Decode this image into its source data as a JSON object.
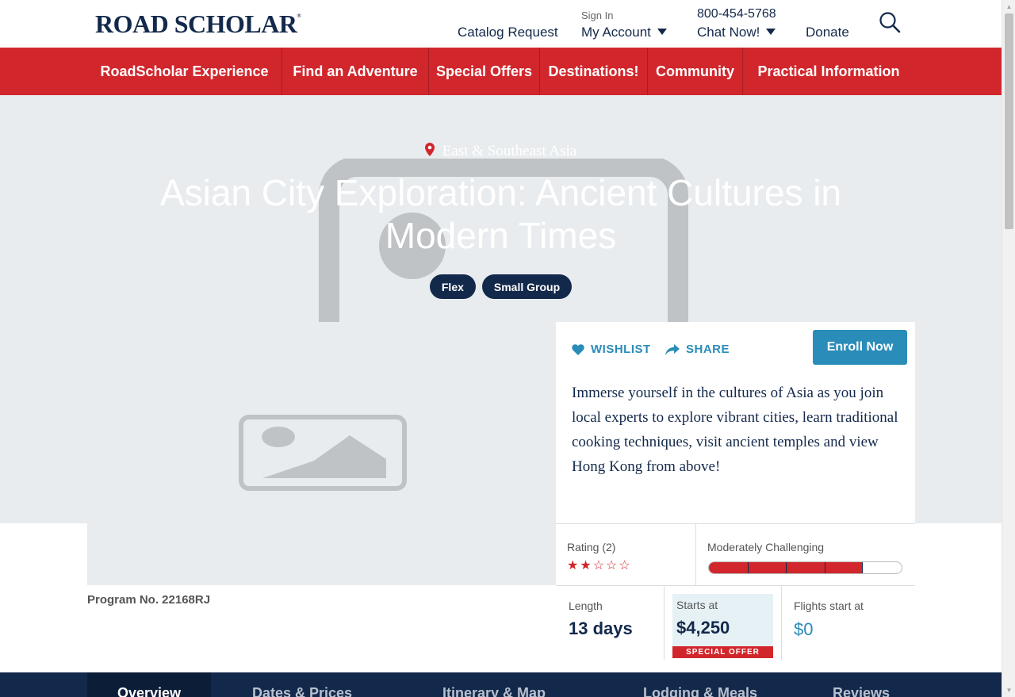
{
  "header": {
    "logo_text": "ROAD SCHOLAR",
    "logo_mark": "®",
    "catalog_request": "Catalog Request",
    "sign_in": "Sign In",
    "my_account": "My Account",
    "phone": "800-454-5768",
    "chat_now": "Chat Now!",
    "donate": "Donate"
  },
  "nav": {
    "items": [
      {
        "label": "RoadScholar Experience"
      },
      {
        "label": "Find an Adventure"
      },
      {
        "label": "Special Offers"
      },
      {
        "label": "Destinations!"
      },
      {
        "label": "Community"
      },
      {
        "label": "Practical Information"
      }
    ]
  },
  "hero": {
    "region": "East & Southeast Asia",
    "title": "Asian City Exploration: Ancient Cultures in Modern Times",
    "tags": [
      "Flex",
      "Small Group"
    ]
  },
  "card": {
    "wishlist": "WISHLIST",
    "share": "SHARE",
    "enroll": "Enroll Now",
    "description": "Immerse yourself in the cultures of Asia as you join local experts to explore vibrant cities, learn traditional cooking techniques, visit ancient temples and view Hong Kong from above!"
  },
  "stats": {
    "rating_label": "Rating (2)",
    "rating_stars": 2,
    "rating_max": 5,
    "difficulty_label": "Moderately Challenging",
    "difficulty_level": 4,
    "difficulty_max": 5,
    "length_label": "Length",
    "length_value": "13 days",
    "price_label": "Starts at",
    "price_value": "$4,250",
    "special_offer": "SPECIAL OFFER",
    "flights_label": "Flights start at",
    "flights_value": "$0"
  },
  "program": "Program No. 22168RJ",
  "tabs": [
    {
      "label": "Overview",
      "active": true
    },
    {
      "label": "Dates & Prices",
      "active": false
    },
    {
      "label": "Itinerary & Map",
      "active": false
    },
    {
      "label": "Lodging & Meals",
      "active": false
    },
    {
      "label": "Reviews",
      "active": false
    }
  ],
  "colors": {
    "brand_red": "#d1262c",
    "navy": "#13294b",
    "accent_blue": "#2a8cb8"
  }
}
